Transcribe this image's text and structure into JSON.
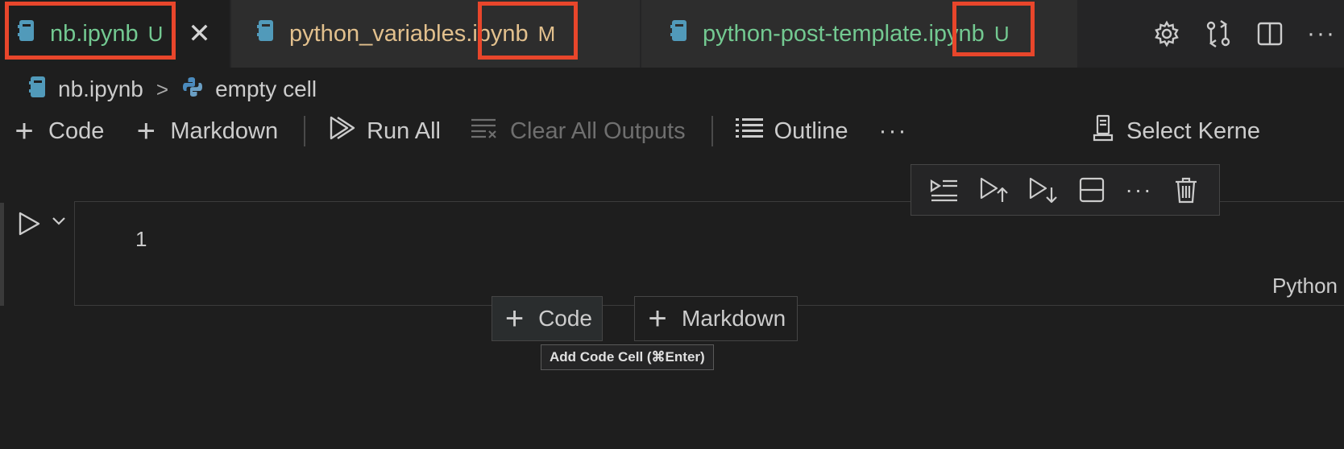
{
  "tabs": [
    {
      "filename": "nb.ipynb",
      "badge": "U",
      "close": "✕",
      "state": "active"
    },
    {
      "filename": "python_variables.ipynb",
      "badge": "M",
      "state": "inactive"
    },
    {
      "filename": "python-post-template.ipynb",
      "badge": "U",
      "state": "inactive"
    }
  ],
  "tab_actions": {
    "icons": [
      "gear-icon",
      "compare-changes-icon",
      "split-editor-icon"
    ],
    "more": "···"
  },
  "breadcrumb": {
    "file": "nb.ipynb",
    "separator": ">",
    "cell": "empty cell"
  },
  "toolbar": {
    "code_label": "Code",
    "markdown_label": "Markdown",
    "run_all_label": "Run All",
    "clear_outputs_label": "Clear All Outputs",
    "outline_label": "Outline",
    "more": "···",
    "select_kernel_label": "Select Kerne"
  },
  "cell": {
    "line_number": "1",
    "language": "Python",
    "toolbar_more": "···",
    "toolbar_icons": [
      "execute-above-icon",
      "run-above-icon",
      "run-below-icon",
      "split-cell-icon",
      "trash-icon"
    ]
  },
  "add_cell": {
    "code_label": "Code",
    "markdown_label": "Markdown",
    "tooltip": "Add Code Cell (⌘Enter)"
  },
  "colors": {
    "untracked": "#73c991",
    "modified": "#e2c08d",
    "highlight": "#e8462b",
    "notebook_icon": "#519aba"
  }
}
